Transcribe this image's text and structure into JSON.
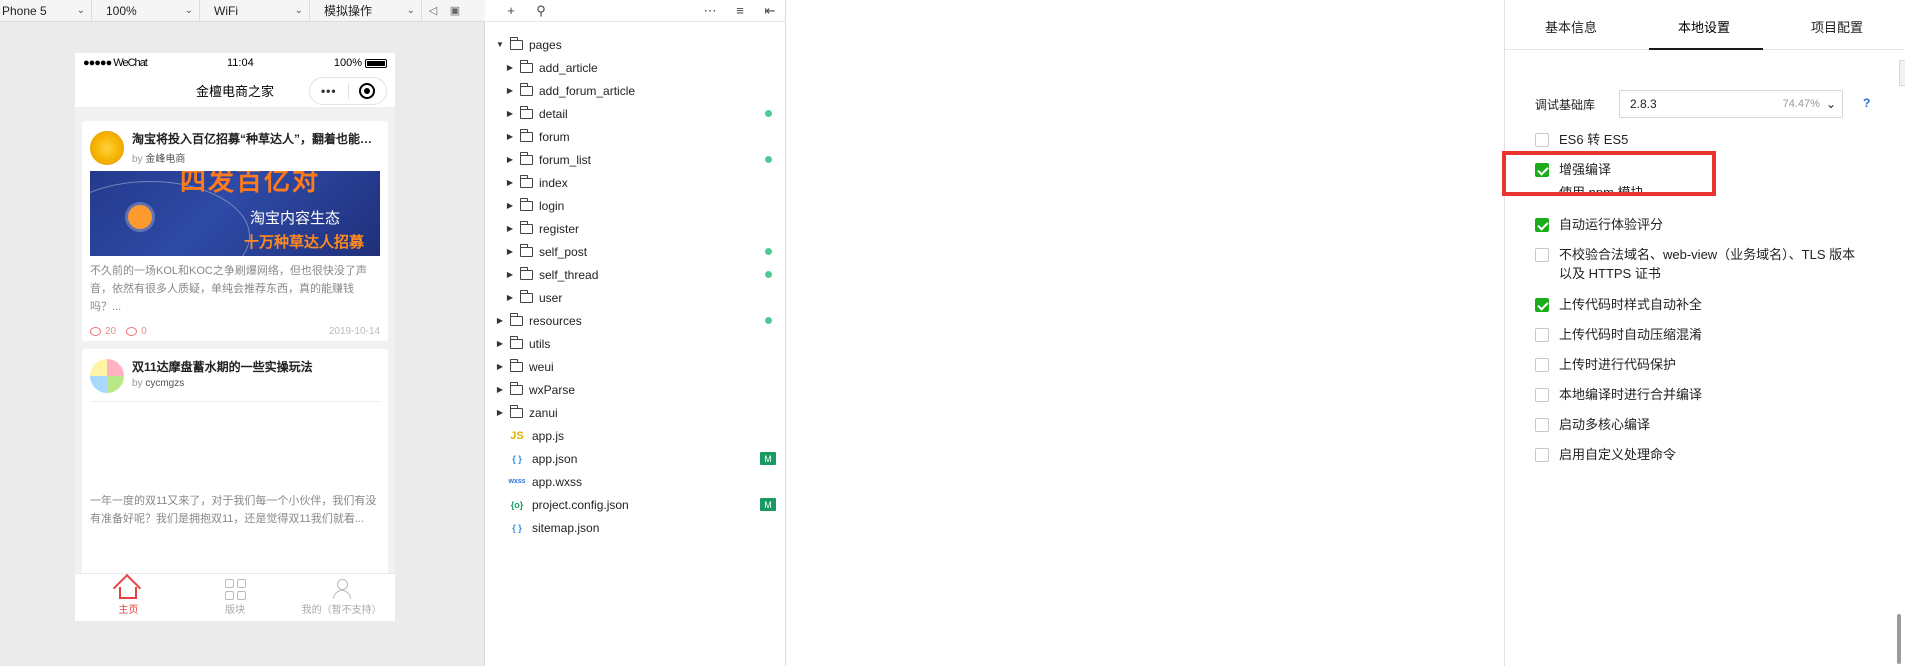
{
  "toolbar": {
    "device": "Phone 5",
    "zoom": "100%",
    "network": "WiFi",
    "mode": "模拟操作"
  },
  "phone": {
    "carrier": "●●●●● WeChat",
    "time": "11:04",
    "battery": "100%",
    "nav_title": "金檀电商之家",
    "capsule_dots": "•••",
    "cards": [
      {
        "title": "淘宝将投入百亿招募“种草达人”，翻着也能赚钱了",
        "by_prefix": "by",
        "author": "金峰电商",
        "banner_big": "四发百亿对",
        "banner_mid": "淘宝内容生态",
        "banner_low": "十万种草达人招募",
        "desc": "不久前的一场KOL和KOC之争刷爆网络，但也很快没了声音，依然有很多人质疑，单纯会推荐东西，真的能赚钱吗？...",
        "views": "20",
        "comments": "0",
        "date": "2019-10-14"
      },
      {
        "title": "双11达摩盘蓄水期的一些实操玩法",
        "by_prefix": "by",
        "author": "cycmgzs",
        "desc": "一年一度的双11又来了，对于我们每一个小伙伴，我们有没有准备好呢？我们是拥抱双11，还是觉得双11我们就看..."
      }
    ],
    "tabs": [
      {
        "label": "主页",
        "active": true
      },
      {
        "label": "版块",
        "active": false
      },
      {
        "label": "我的（暂不支持）",
        "active": false
      }
    ]
  },
  "file_tree": {
    "toolbar_icons": [
      "plus-icon",
      "search-icon",
      "more-icon",
      "collapse-icon",
      "split-icon"
    ],
    "items": [
      {
        "name": "pages",
        "type": "folder",
        "expanded": true,
        "depth": 0,
        "badge": ""
      },
      {
        "name": "add_article",
        "type": "folder",
        "depth": 1,
        "badge": ""
      },
      {
        "name": "add_forum_article",
        "type": "folder",
        "depth": 1,
        "badge": ""
      },
      {
        "name": "detail",
        "type": "folder",
        "depth": 1,
        "badge": "dot"
      },
      {
        "name": "forum",
        "type": "folder",
        "depth": 1,
        "badge": ""
      },
      {
        "name": "forum_list",
        "type": "folder",
        "depth": 1,
        "badge": "dot"
      },
      {
        "name": "index",
        "type": "folder",
        "depth": 1,
        "badge": ""
      },
      {
        "name": "login",
        "type": "folder",
        "depth": 1,
        "badge": ""
      },
      {
        "name": "register",
        "type": "folder",
        "depth": 1,
        "badge": ""
      },
      {
        "name": "self_post",
        "type": "folder",
        "depth": 1,
        "badge": "dot"
      },
      {
        "name": "self_thread",
        "type": "folder",
        "depth": 1,
        "badge": "dot"
      },
      {
        "name": "user",
        "type": "folder",
        "depth": 1,
        "badge": ""
      },
      {
        "name": "resources",
        "type": "folder",
        "depth": 0,
        "badge": "dot"
      },
      {
        "name": "utils",
        "type": "folder",
        "depth": 0,
        "badge": ""
      },
      {
        "name": "weui",
        "type": "folder",
        "depth": 0,
        "badge": ""
      },
      {
        "name": "wxParse",
        "type": "folder",
        "depth": 0,
        "badge": ""
      },
      {
        "name": "zanui",
        "type": "folder",
        "depth": 0,
        "badge": ""
      },
      {
        "name": "app.js",
        "type": "js",
        "icon_text": "JS",
        "depth": 0,
        "badge": ""
      },
      {
        "name": "app.json",
        "type": "json",
        "icon_text": "{ }",
        "depth": 0,
        "badge": "M"
      },
      {
        "name": "app.wxss",
        "type": "wxss",
        "icon_text": "wxss",
        "depth": 0,
        "badge": ""
      },
      {
        "name": "project.config.json",
        "type": "cfg",
        "icon_text": "{o}",
        "depth": 0,
        "badge": "M"
      },
      {
        "name": "sitemap.json",
        "type": "json",
        "icon_text": "{ }",
        "depth": 0,
        "badge": ""
      }
    ]
  },
  "settings": {
    "tabs": [
      "基本信息",
      "本地设置",
      "项目配置"
    ],
    "active_tab": "本地设置",
    "lib_label": "调试基础库",
    "lib_version": "2.8.3",
    "lib_percent": "74.47%",
    "help": "?",
    "options": [
      {
        "label": "ES6 转 ES5",
        "checked": false
      },
      {
        "label": "增强编译",
        "checked": true
      },
      {
        "label": "自动运行体验评分",
        "checked": true
      },
      {
        "label": "不校验合法域名、web-view（业务域名）、TLS 版本以及 HTTPS 证书",
        "checked": false
      },
      {
        "label": "上传代码时样式自动补全",
        "checked": true
      },
      {
        "label": "上传代码时自动压缩混淆",
        "checked": false
      },
      {
        "label": "上传时进行代码保护",
        "checked": false
      },
      {
        "label": "本地编译时进行合并编译",
        "checked": false
      },
      {
        "label": "启动多核心编译",
        "checked": false
      },
      {
        "label": "启用自定义处理命令",
        "checked": false
      }
    ],
    "clipped_option": "使用 npm 模块",
    "highlight_color": "#e8332e",
    "check_color": "#1aad19"
  }
}
